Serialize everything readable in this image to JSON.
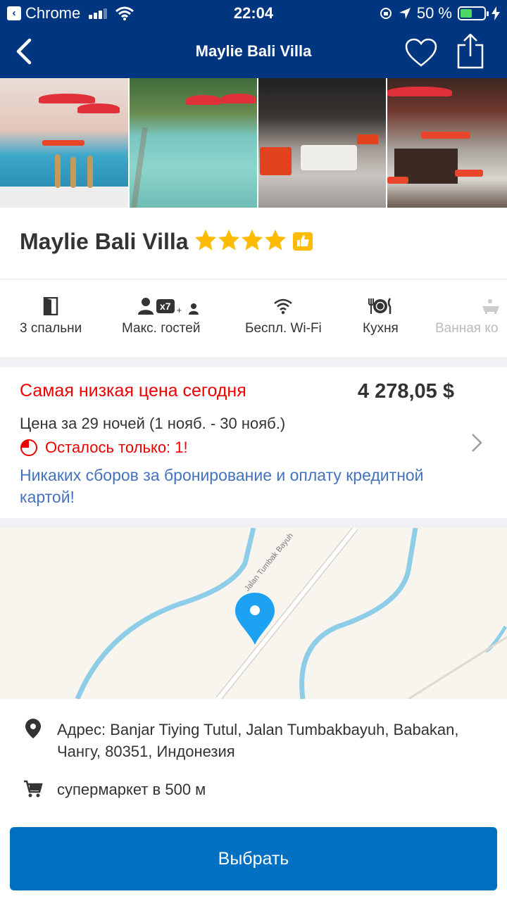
{
  "status_bar": {
    "app": "Chrome",
    "time": "22:04",
    "battery": "50 %",
    "battery_level": 0.5
  },
  "nav": {
    "title": "Maylie Bali Villa",
    "back_icon": "chevron-left-icon",
    "favorite_icon": "heart-icon",
    "share_icon": "share-icon"
  },
  "hotel": {
    "name": "Maylie Bali Villa",
    "stars": 4,
    "badge_icon": "thumbs-up-icon"
  },
  "facilities": [
    {
      "label": "3 спальни",
      "icon": "door-icon"
    },
    {
      "label": "Макс. гостей",
      "icon": "guests-icon",
      "badge": "x7"
    },
    {
      "label": "Беспл. Wi-Fi",
      "icon": "wifi-icon"
    },
    {
      "label": "Кухня",
      "icon": "dining-icon"
    },
    {
      "label": "Ванная ко",
      "icon": "bathtub-icon"
    }
  ],
  "price": {
    "lowest_label": "Самая низкая цена сегодня",
    "amount": "4 278,05 $",
    "nights": "Цена за 29 ночей (1 нояб. - 30 нояб.)",
    "left": "Осталось только: 1!",
    "fees": "Никаких сборов за бронирование и оплату кредитной картой!"
  },
  "map": {
    "street": "Jalan Tumbak Bayuh"
  },
  "address": {
    "text": "Адрес: Banjar Tiying Tutul, Jalan Tumbakbayuh, Babakan, Чангу, 80351, Индонезия",
    "nearby": "супермаркет в 500 м"
  },
  "cta": {
    "label": "Выбрать"
  },
  "colors": {
    "brand": "#003580",
    "button": "#0071c2",
    "star": "#febb02",
    "alert": "#e00000",
    "link": "#4572bd"
  }
}
